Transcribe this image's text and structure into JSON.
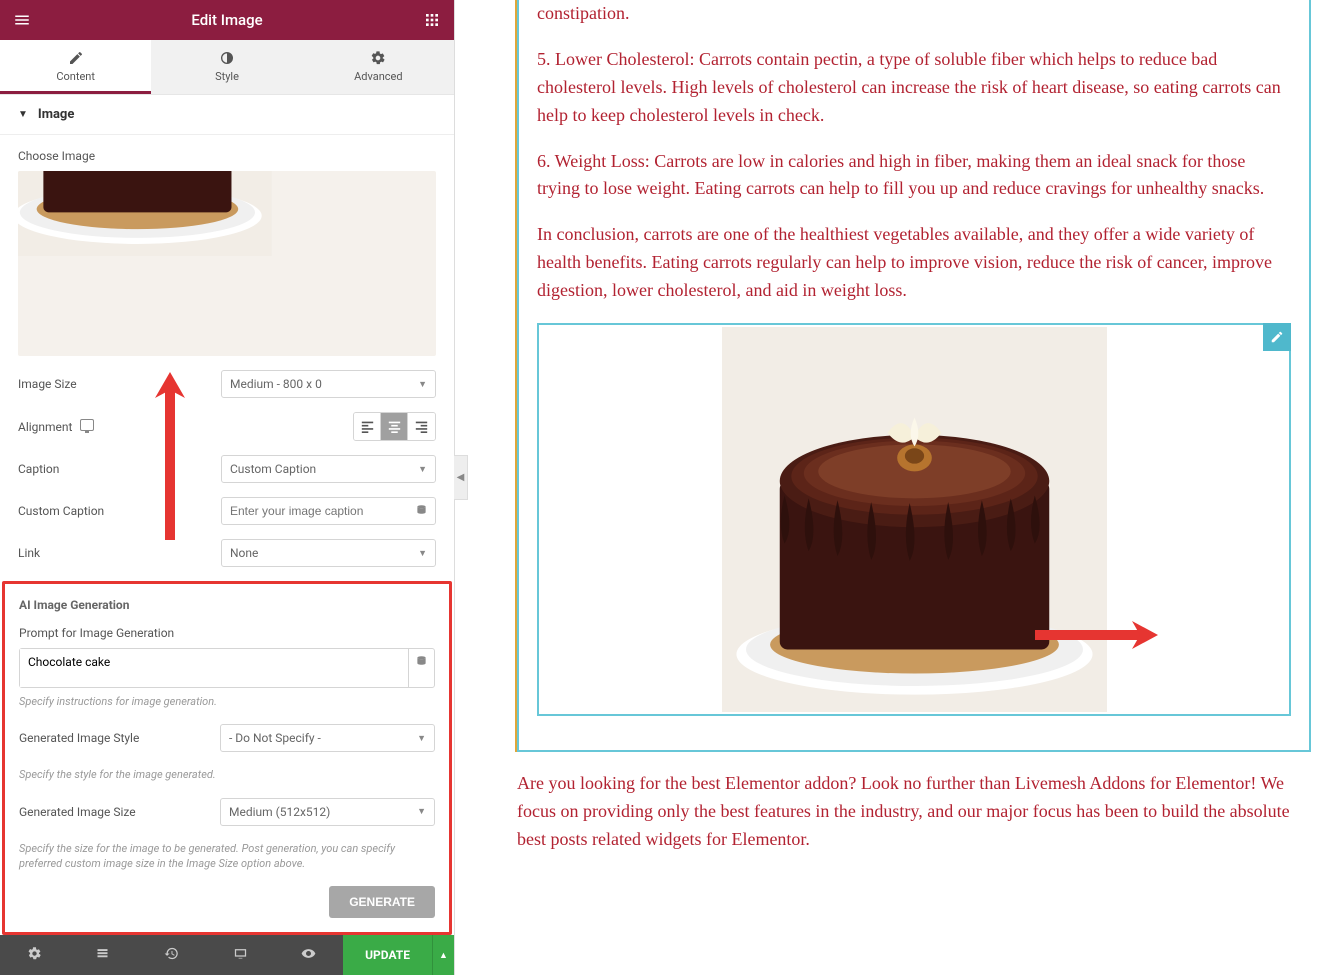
{
  "header": {
    "title": "Edit Image"
  },
  "tabs": {
    "content": "Content",
    "style": "Style",
    "advanced": "Advanced"
  },
  "section": {
    "title": "Image"
  },
  "image": {
    "choose_label": "Choose Image",
    "size_label": "Image Size",
    "size_value": "Medium - 800 x 0",
    "alignment_label": "Alignment",
    "caption_label": "Caption",
    "caption_value": "Custom Caption",
    "custom_caption_label": "Custom Caption",
    "custom_caption_placeholder": "Enter your image caption",
    "link_label": "Link",
    "link_value": "None"
  },
  "ai": {
    "title": "AI Image Generation",
    "prompt_label": "Prompt for Image Generation",
    "prompt_value": "Chocolate cake",
    "prompt_hint": "Specify instructions for image generation.",
    "style_label": "Generated Image Style",
    "style_value": "- Do Not Specify -",
    "style_hint": "Specify the style for the image generated.",
    "size_label": "Generated Image Size",
    "size_value": "Medium (512x512)",
    "size_hint": "Specify the size for the image to be generated. Post generation, you can specify preferred custom image size in the Image Size option above.",
    "generate_btn": "GENERATE"
  },
  "footer": {
    "update": "UPDATE"
  },
  "article": {
    "p4_partial": "constipation.",
    "p5": "5. Lower Cholesterol: Carrots contain pectin, a type of soluble fiber which helps to reduce bad cholesterol levels. High levels of cholesterol can increase the risk of heart disease, so eating carrots can help to keep cholesterol levels in check.",
    "p6": "6. Weight Loss: Carrots are low in calories and high in fiber, making them an ideal snack for those trying to lose weight. Eating carrots can help to fill you up and reduce cravings for unhealthy snacks.",
    "p7": "In conclusion, carrots are one of the healthiest vegetables available, and they offer a wide variety of health benefits. Eating carrots regularly can help to improve vision, reduce the risk of cancer, improve digestion, lower cholesterol, and aid in weight loss.",
    "below": "Are you looking for the best Elementor addon? Look no further than Livemesh Addons for Elementor! We focus on providing only the best features in the industry, and our major focus has been to build the absolute best posts related widgets for Elementor."
  }
}
